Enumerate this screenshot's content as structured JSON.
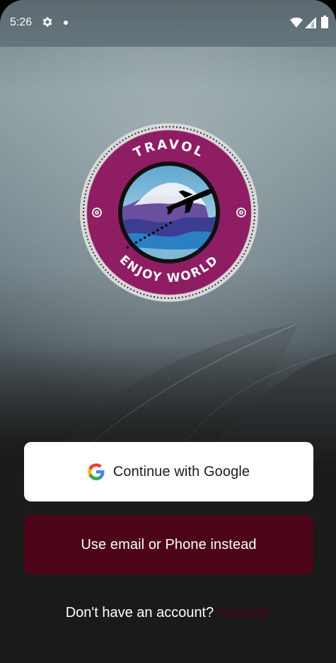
{
  "status_bar": {
    "time": "5:26",
    "icons": [
      "gear-icon",
      "notification-dot-icon",
      "wifi-icon",
      "signal-icon",
      "battery-icon"
    ]
  },
  "logo": {
    "top_text": "TRAVOL",
    "bottom_text": "ENJOY WORLD",
    "ring_color": "#8e1d63"
  },
  "actions": {
    "google_label": "Continue with Google",
    "email_label": "Use email or Phone instead"
  },
  "footer": {
    "prompt": "Don't have an account? ",
    "register_label": "Register"
  },
  "colors": {
    "accent": "#4d0519",
    "google_button_bg": "#ffffff",
    "background_dark": "#1a1a1a"
  }
}
